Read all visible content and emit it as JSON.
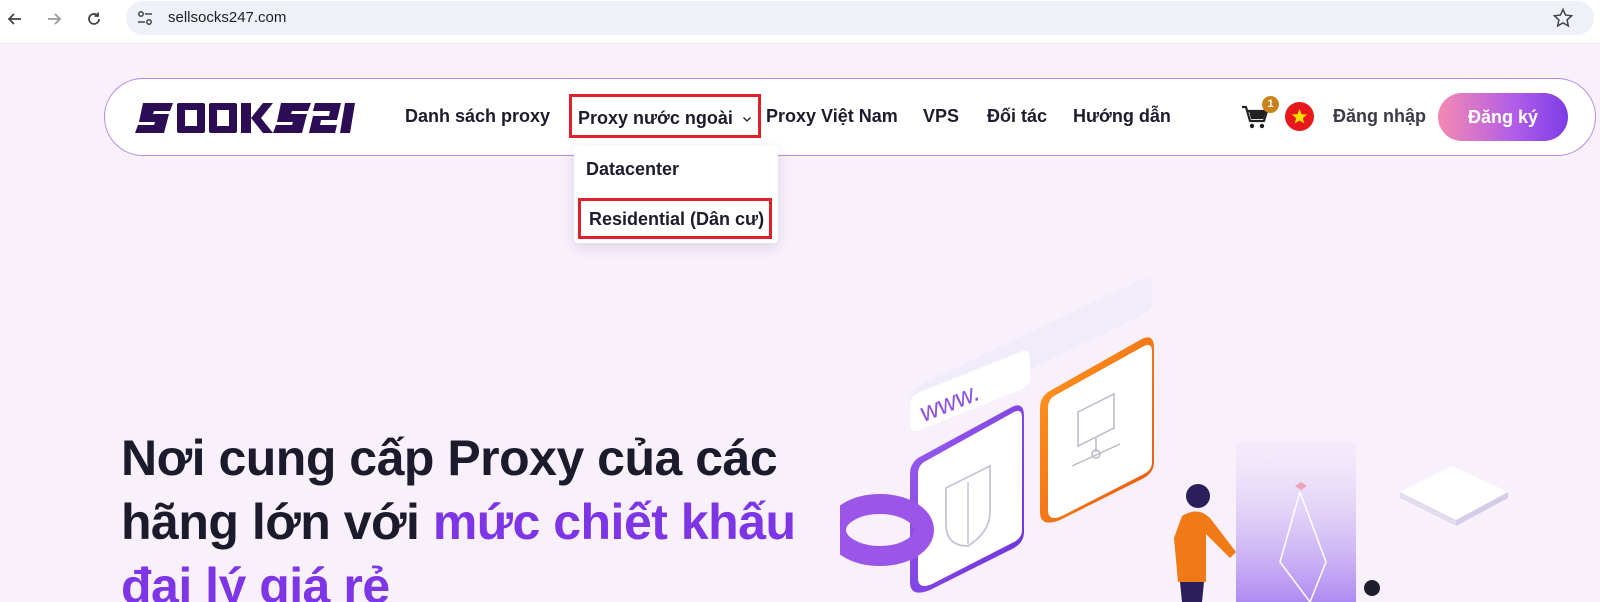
{
  "browser": {
    "url": "sellsocks247.com",
    "back_icon": "arrow-left-icon",
    "forward_icon": "arrow-right-icon",
    "reload_icon": "reload-icon",
    "site_info_icon": "tune-icon",
    "bookmark_icon": "star-icon"
  },
  "header": {
    "logo_text": "SOCKS247",
    "nav": [
      {
        "label": "Danh sách proxy"
      },
      {
        "label": "Proxy nước ngoài"
      },
      {
        "label": "Proxy Việt Nam"
      },
      {
        "label": "VPS"
      },
      {
        "label": "Đối tác"
      },
      {
        "label": "Hướng dẫn"
      }
    ],
    "cart_count": "1",
    "cart_icon": "cart-icon",
    "language_flag": "vietnam-flag-icon",
    "login_label": "Đăng nhập",
    "signup_label": "Đăng ký"
  },
  "dropdown": {
    "items": [
      {
        "label": "Datacenter"
      },
      {
        "label": "Residential (Dân cư)"
      }
    ]
  },
  "hero": {
    "title_line1": "Nơi cung cấp Proxy của các",
    "title_line2_plain": "hãng lớn với ",
    "title_line2_accent": "mức chiết khấu",
    "title_line3_accent": "đại lý giá rẻ",
    "illustration_text": "www."
  },
  "colors": {
    "accent": "#7d35e6",
    "highlight_box": "#e0202a",
    "background": "#f8f0fb",
    "signup_gradient_start": "#f48ab0",
    "signup_gradient_end": "#7b3de6"
  }
}
